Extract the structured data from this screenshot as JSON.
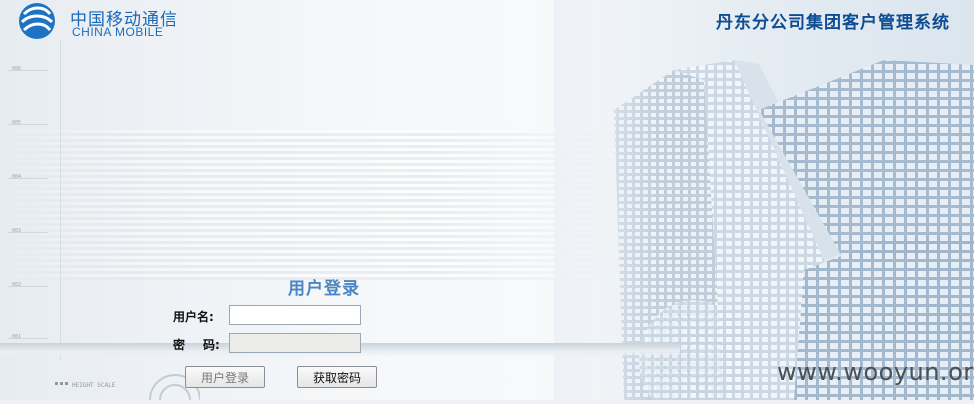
{
  "header": {
    "logo_cn": "中国移动通信",
    "logo_en": "CHINA MOBILE",
    "system_title": "丹东分公司集团客户管理系统"
  },
  "login": {
    "title": "用户登录",
    "username_label": "用户名:",
    "password_label_1": "密",
    "password_label_2": "码:",
    "username_value": "",
    "password_value": "",
    "login_button": "用户登录",
    "get_password_button": "获取密码"
  },
  "decor": {
    "scale_numbers": [
      "006",
      "005",
      "004",
      "003",
      "002",
      "001"
    ],
    "height_scale_text": "HEIGHT SCALE"
  },
  "watermark": "www.wooyun.org",
  "colors": {
    "brand_blue": "#1769b8",
    "title_blue": "#0e4d92",
    "login_title_blue": "#4a86c4"
  }
}
